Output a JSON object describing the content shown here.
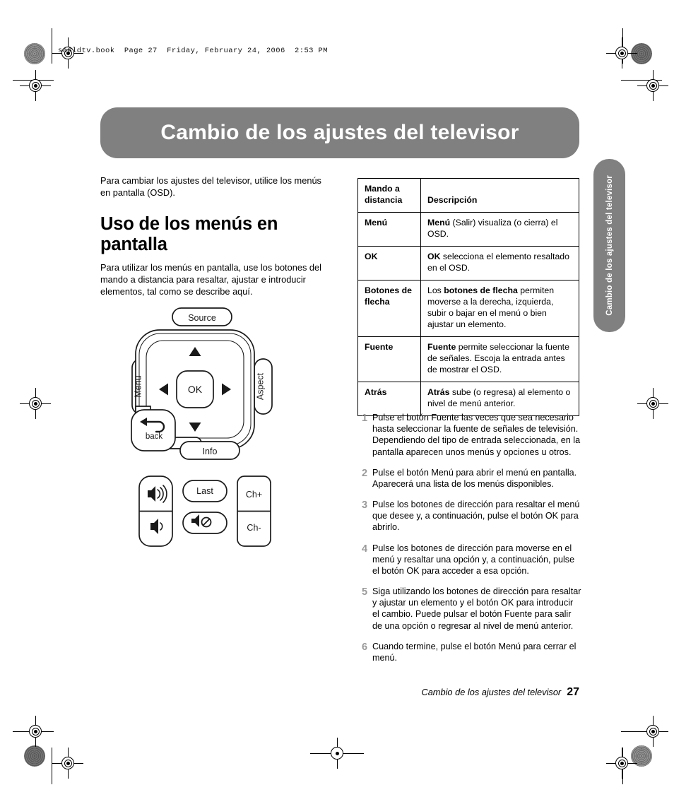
{
  "print": {
    "book_line": "sa6ldtv.book  Page 27  Friday, February 24, 2006  2:53 PM"
  },
  "banner": {
    "title": "Cambio de los ajustes del televisor"
  },
  "side_tab": {
    "label": "Cambio de los ajustes del televisor"
  },
  "left": {
    "intro": "Para cambiar los ajustes del televisor, utilice los menús en pantalla (OSD).",
    "heading": "Uso de los menús en pantalla",
    "paragraph": "Para utilizar los menús en pantalla, use los botones del mando a distancia para resaltar, ajustar e introducir elementos, tal como se describe aquí."
  },
  "remote": {
    "source_label": "Source",
    "menu_label": "Menu",
    "aspect_label": "Aspect",
    "ok_label": "OK",
    "back_label": "back",
    "info_label": "Info",
    "last_label": "Last",
    "ch_up_label": "Ch+",
    "ch_down_label": "Ch-",
    "icons": {
      "up": "arrow-up-icon",
      "down": "arrow-down-icon",
      "left": "arrow-left-icon",
      "right": "arrow-right-icon",
      "back": "back-arrow-icon",
      "volume_up": "volume-up-icon",
      "volume_down": "volume-down-icon",
      "mute": "mute-icon"
    }
  },
  "table": {
    "headers": {
      "col1": "Mando a distancia",
      "col2": "Descripción"
    },
    "rows": [
      {
        "key": "Menú",
        "desc_bold": "Menú",
        "desc_rest": " (Salir) visualiza (o cierra) el OSD."
      },
      {
        "key": "OK",
        "desc_bold": "OK",
        "desc_rest": " selecciona el elemento resaltado en el OSD."
      },
      {
        "key": "Botones de flecha",
        "desc_pre": "Los ",
        "desc_bold": "botones de flecha",
        "desc_rest": " permiten moverse a la derecha, izquierda, subir o bajar en el menú o bien ajustar un elemento."
      },
      {
        "key": "Fuente",
        "desc_bold": "Fuente",
        "desc_rest": " permite seleccionar la fuente de señales. Escoja la entrada antes de mostrar el OSD."
      },
      {
        "key": "Atrás",
        "desc_bold": "Atrás",
        "desc_rest": " sube (o regresa) al elemento o nivel de menú anterior."
      }
    ]
  },
  "steps": [
    {
      "num": "1",
      "text": "Pulse el botón Fuente las veces que sea necesario hasta seleccionar la fuente de señales de televisión. Dependiendo del tipo de entrada seleccionada, en la pantalla aparecen unos menús y opciones u otros."
    },
    {
      "num": "2",
      "text": "Pulse el botón Menú para abrir el menú en pantalla. Aparecerá una lista de los menús disponibles."
    },
    {
      "num": "3",
      "text": "Pulse los botones de dirección para resaltar el menú que desee y, a continuación, pulse el botón OK para abrirlo."
    },
    {
      "num": "4",
      "text": "Pulse los botones de dirección para moverse en el menú y resaltar una opción y, a continuación, pulse el botón OK para acceder a esa opción."
    },
    {
      "num": "5",
      "text": "Siga utilizando los botones de dirección para resaltar y ajustar un elemento y el botón OK para introducir el cambio. Puede pulsar el botón Fuente para salir de una opción o regresar al nivel de menú anterior."
    },
    {
      "num": "6",
      "text": "Cuando termine, pulse el botón Menú para cerrar el menú."
    }
  ],
  "footer": {
    "title": "Cambio de los ajustes del televisor",
    "page": "27"
  },
  "colors": {
    "banner_gray": "#808080",
    "step_number_gray": "#9a9a9a",
    "text_black": "#000000"
  }
}
